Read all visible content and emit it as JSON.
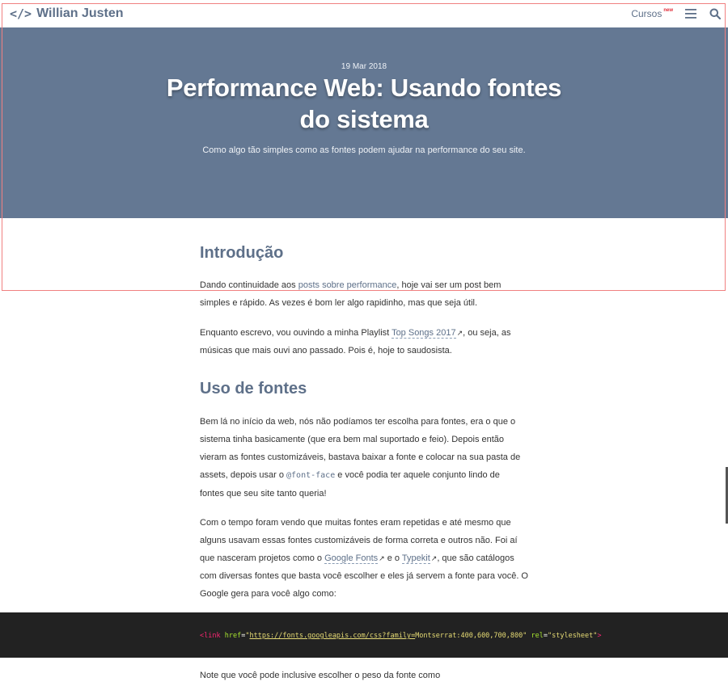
{
  "header": {
    "brand_code": "</>",
    "brand_name": "Willian Justen",
    "cursos_label": "Cursos",
    "new_badge": "new",
    "menu_icon": "hamburger-menu-icon",
    "search_icon": "search-icon"
  },
  "hero": {
    "date": "19 Mar 2018",
    "title": "Performance Web: Usando fontes do sistema",
    "subtitle": "Como algo tão simples como as fontes podem ajudar na performance do seu site.",
    "background_color": "#647893"
  },
  "article": {
    "intro_heading": "Introdução",
    "p1_a": "Dando continuidade aos ",
    "p1_link": "posts sobre performance",
    "p1_b": ", hoje vai ser um post bem simples e rápido. As vezes é bom ler algo rapidinho, mas que seja útil.",
    "p2_a": "Enquanto escrevo, vou ouvindo a minha Playlist ",
    "p2_link": "Top Songs 2017",
    "p2_b": ", ou seja, as músicas que mais ouvi ano passado. Pois é, hoje to saudosista.",
    "fonts_heading": "Uso de fontes",
    "p3_a": "Bem lá no início da web, nós não podíamos ter escolha para fontes, era o que o sistema tinha basicamente (que era bem mal suportado e feio). Depois então vieram as fontes customizáveis, bastava baixar a fonte e colocar na sua pasta de assets, depois usar o ",
    "p3_code": "@font-face",
    "p3_b": " e você podia ter aquele conjunto lindo de fontes que seu site tanto queria!",
    "p4_a": "Com o tempo foram vendo que muitas fontes eram repetidas e até mesmo que alguns usavam essas fontes customizáveis de forma correta e outros não. Foi aí que nasceram projetos como o ",
    "p4_link1": "Google Fonts",
    "p4_mid": " e o ",
    "p4_link2": "Typekit",
    "p4_b": ", que são catálogos com diversas fontes que basta você escolher e eles já servem a fonte para você. O Google gera para você algo como:",
    "p5": "Note que você pode inclusive escolher o peso da fonte como"
  },
  "code": {
    "open": "<",
    "tag": "link",
    "attr1": "href",
    "eq": "=",
    "quote": "\"",
    "url_a": "https://fonts.googleapis.com/css?family",
    "url_eq": "=",
    "url_b": "Montserrat:400,600,700,800",
    "attr2": "rel",
    "rel_val": "\"stylesheet\"",
    "close": ">"
  }
}
